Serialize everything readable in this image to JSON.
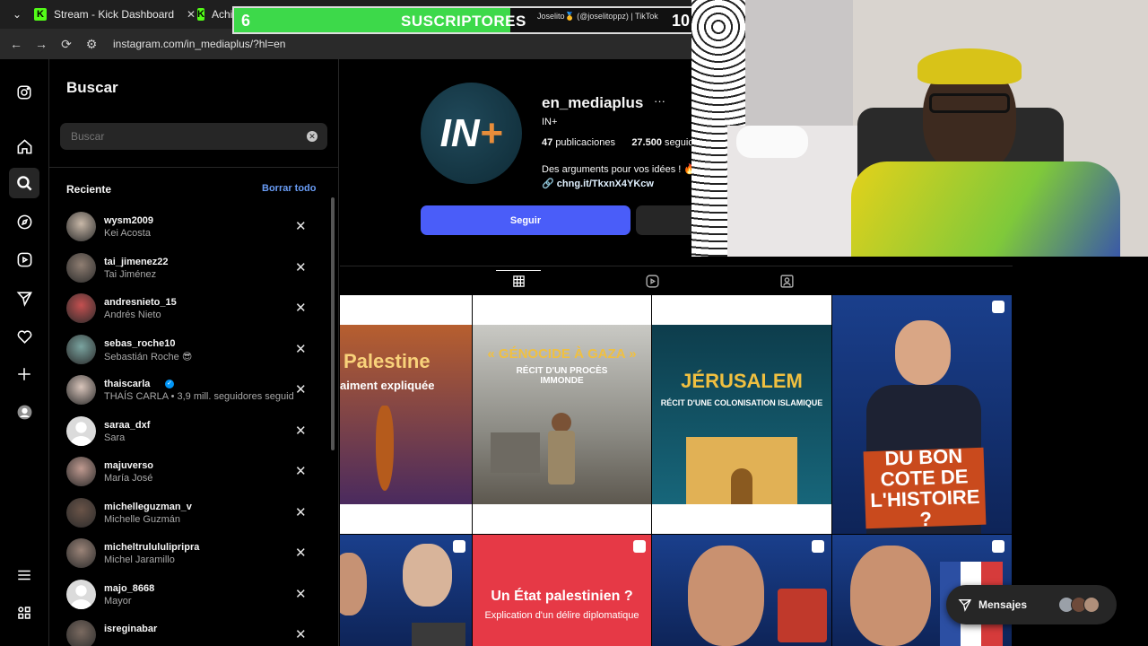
{
  "browser": {
    "tabs": [
      {
        "title": "Stream - Kick Dashboard"
      },
      {
        "title": "Achiev"
      },
      {
        "title": "Joselito🥇 (@joselitoppz) | TikTok"
      }
    ],
    "url": "instagram.com/in_mediaplus/?hl=en"
  },
  "overlay": {
    "current": "6",
    "label": "SUSCRIPTORES",
    "goal": "10",
    "progress": 0.6,
    "colors": {
      "fill": "#3dd94a",
      "track": "#111111"
    }
  },
  "rail": {
    "icons": [
      "instagram-icon",
      "home-icon",
      "search-icon",
      "explore-icon",
      "reels-icon",
      "messages-icon",
      "notifications-icon",
      "create-icon",
      "profile-icon",
      "menu-icon",
      "more-apps-icon"
    ]
  },
  "search": {
    "title": "Buscar",
    "placeholder": "Buscar",
    "recent_title": "Reciente",
    "clear_all": "Borrar todo",
    "items": [
      {
        "username": "wysm2009",
        "name": "Kei Acosta",
        "verified": false
      },
      {
        "username": "tai_jimenez22",
        "name": "Tai Jiménez",
        "verified": false
      },
      {
        "username": "andresnieto_15",
        "name": "Andrés Nieto",
        "verified": false
      },
      {
        "username": "sebas_roche10",
        "name": "Sebastián Roche 😎",
        "verified": false
      },
      {
        "username": "thaiscarla",
        "name": "THAÍS CARLA • 3,9 mill. seguidores seguid",
        "verified": true
      },
      {
        "username": "saraa_dxf",
        "name": "Sara",
        "verified": false
      },
      {
        "username": "majuverso",
        "name": "María José",
        "verified": false
      },
      {
        "username": "michelleguzman_v",
        "name": "Michelle Guzmán",
        "verified": false
      },
      {
        "username": "micheltrulululipripra",
        "name": "Michel Jaramillo",
        "verified": false
      },
      {
        "username": "majo_8668",
        "name": "Mayor",
        "verified": false
      },
      {
        "username": "isreginabar",
        "name": "",
        "verified": false
      }
    ]
  },
  "profile": {
    "logo_text": "IN",
    "logo_plus": "+",
    "username": "en_mediaplus",
    "more": "···",
    "display_name": "IN+",
    "posts_count": "47",
    "posts_label": "publicaciones",
    "followers_count": "27.500",
    "followers_label": "seguidor",
    "bio": "Des arguments pour vos idées ! 🔥",
    "link": "chng.it/TkxnX4YKcw",
    "follow_label": "Seguir"
  },
  "grid": {
    "posts": [
      {
        "title": "Palestine",
        "subtitle": "aiment expliquée"
      },
      {
        "title": "« GÉNOCIDE À GAZA »",
        "subtitle": "RÉCIT D'UN PROCÈS IMMONDE"
      },
      {
        "title": "JÉRUSALEM",
        "subtitle": "RÉCIT D'UNE COLONISATION ISLAMIQUE"
      },
      {
        "title": "DU BON COTE DE L'HISTOIRE ?",
        "subtitle": ""
      },
      {
        "title": "",
        "subtitle": ""
      },
      {
        "title": "Un État palestinien ?",
        "subtitle": "Explication d'un délire diplomatique"
      },
      {
        "title": "",
        "subtitle": ""
      },
      {
        "title": "",
        "subtitle": ""
      }
    ]
  },
  "messages": {
    "label": "Mensajes"
  }
}
